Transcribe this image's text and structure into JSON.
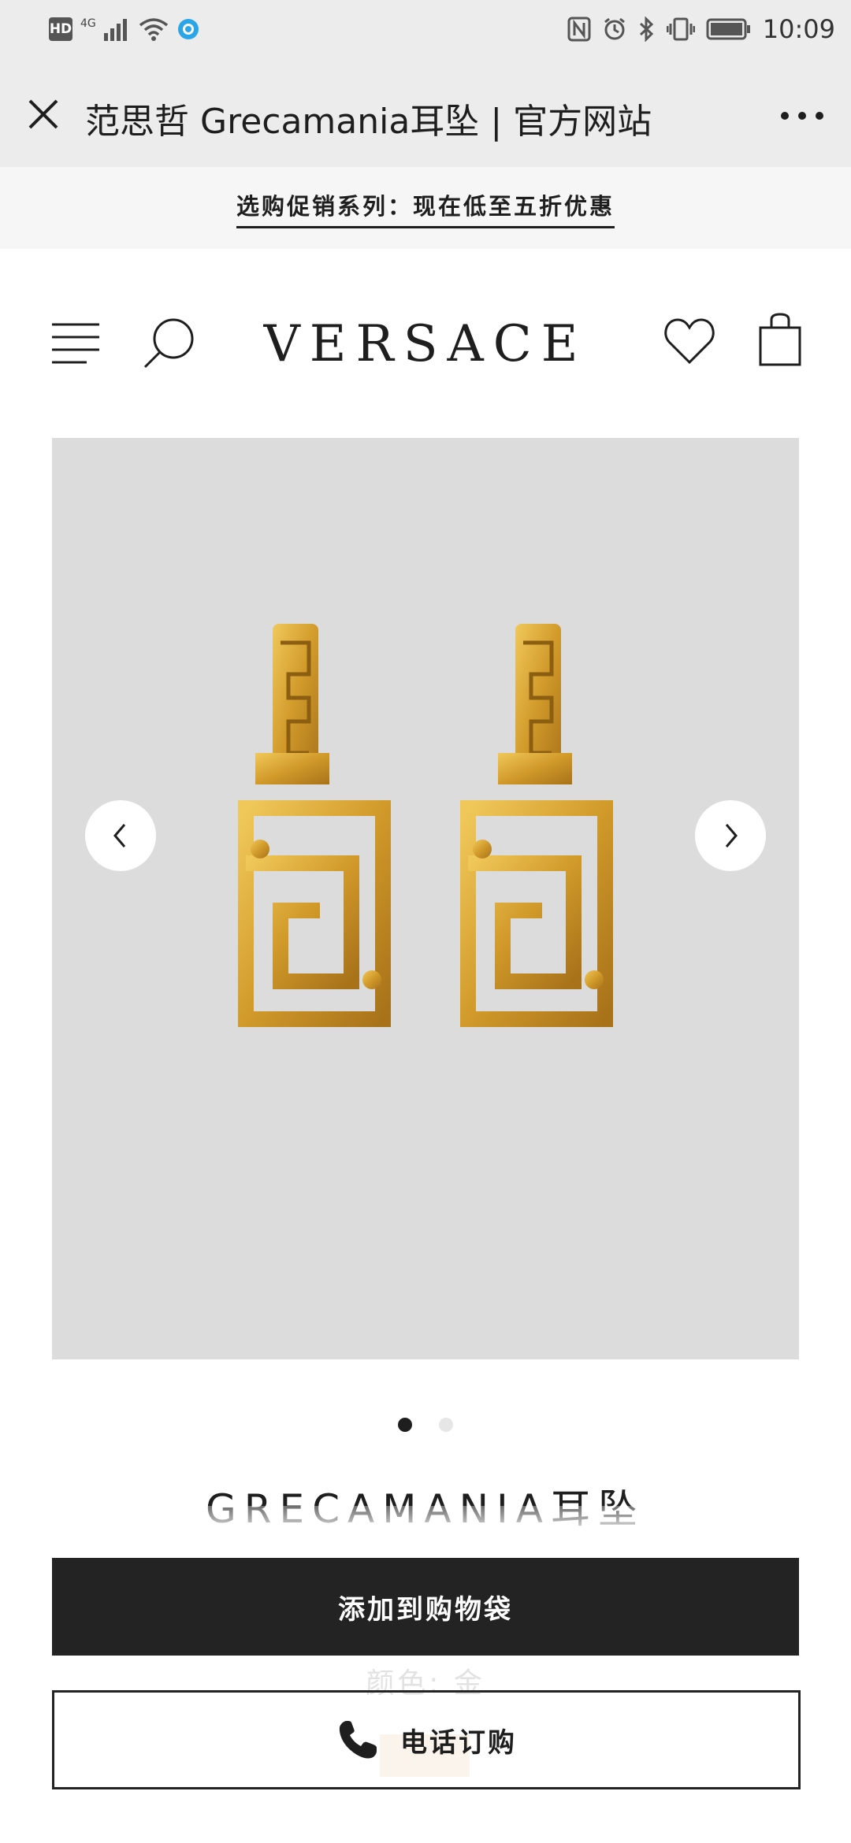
{
  "status_bar": {
    "hd": "HD",
    "network": "4G",
    "time": "10:09"
  },
  "webview": {
    "title": "范思哲 Grecamania耳坠 | 官方网站",
    "close_icon": "close-icon",
    "more_icon": "more-dots-icon"
  },
  "promo": {
    "text": "选购促销系列：现在低至五折优惠"
  },
  "site_header": {
    "logo": "VERSACE",
    "icons": [
      "menu-icon",
      "search-icon",
      "heart-icon",
      "shopping-bag-icon"
    ]
  },
  "gallery": {
    "prev_icon": "chevron-left-icon",
    "next_icon": "chevron-right-icon",
    "image_count": 2,
    "active_index": 1,
    "background": "#dcdcdc",
    "gold": "#d4a43a"
  },
  "product": {
    "title": "GRECAMANIA耳坠",
    "color_label": "颜色: 金"
  },
  "actions": {
    "add_to_bag": "添加到购物袋",
    "phone_order": "电话订购",
    "phone_icon": "phone-icon"
  },
  "colors": {
    "button_dark": "#232323",
    "promo_bg": "#f6f6f6",
    "chrome_bg": "#ececec"
  }
}
